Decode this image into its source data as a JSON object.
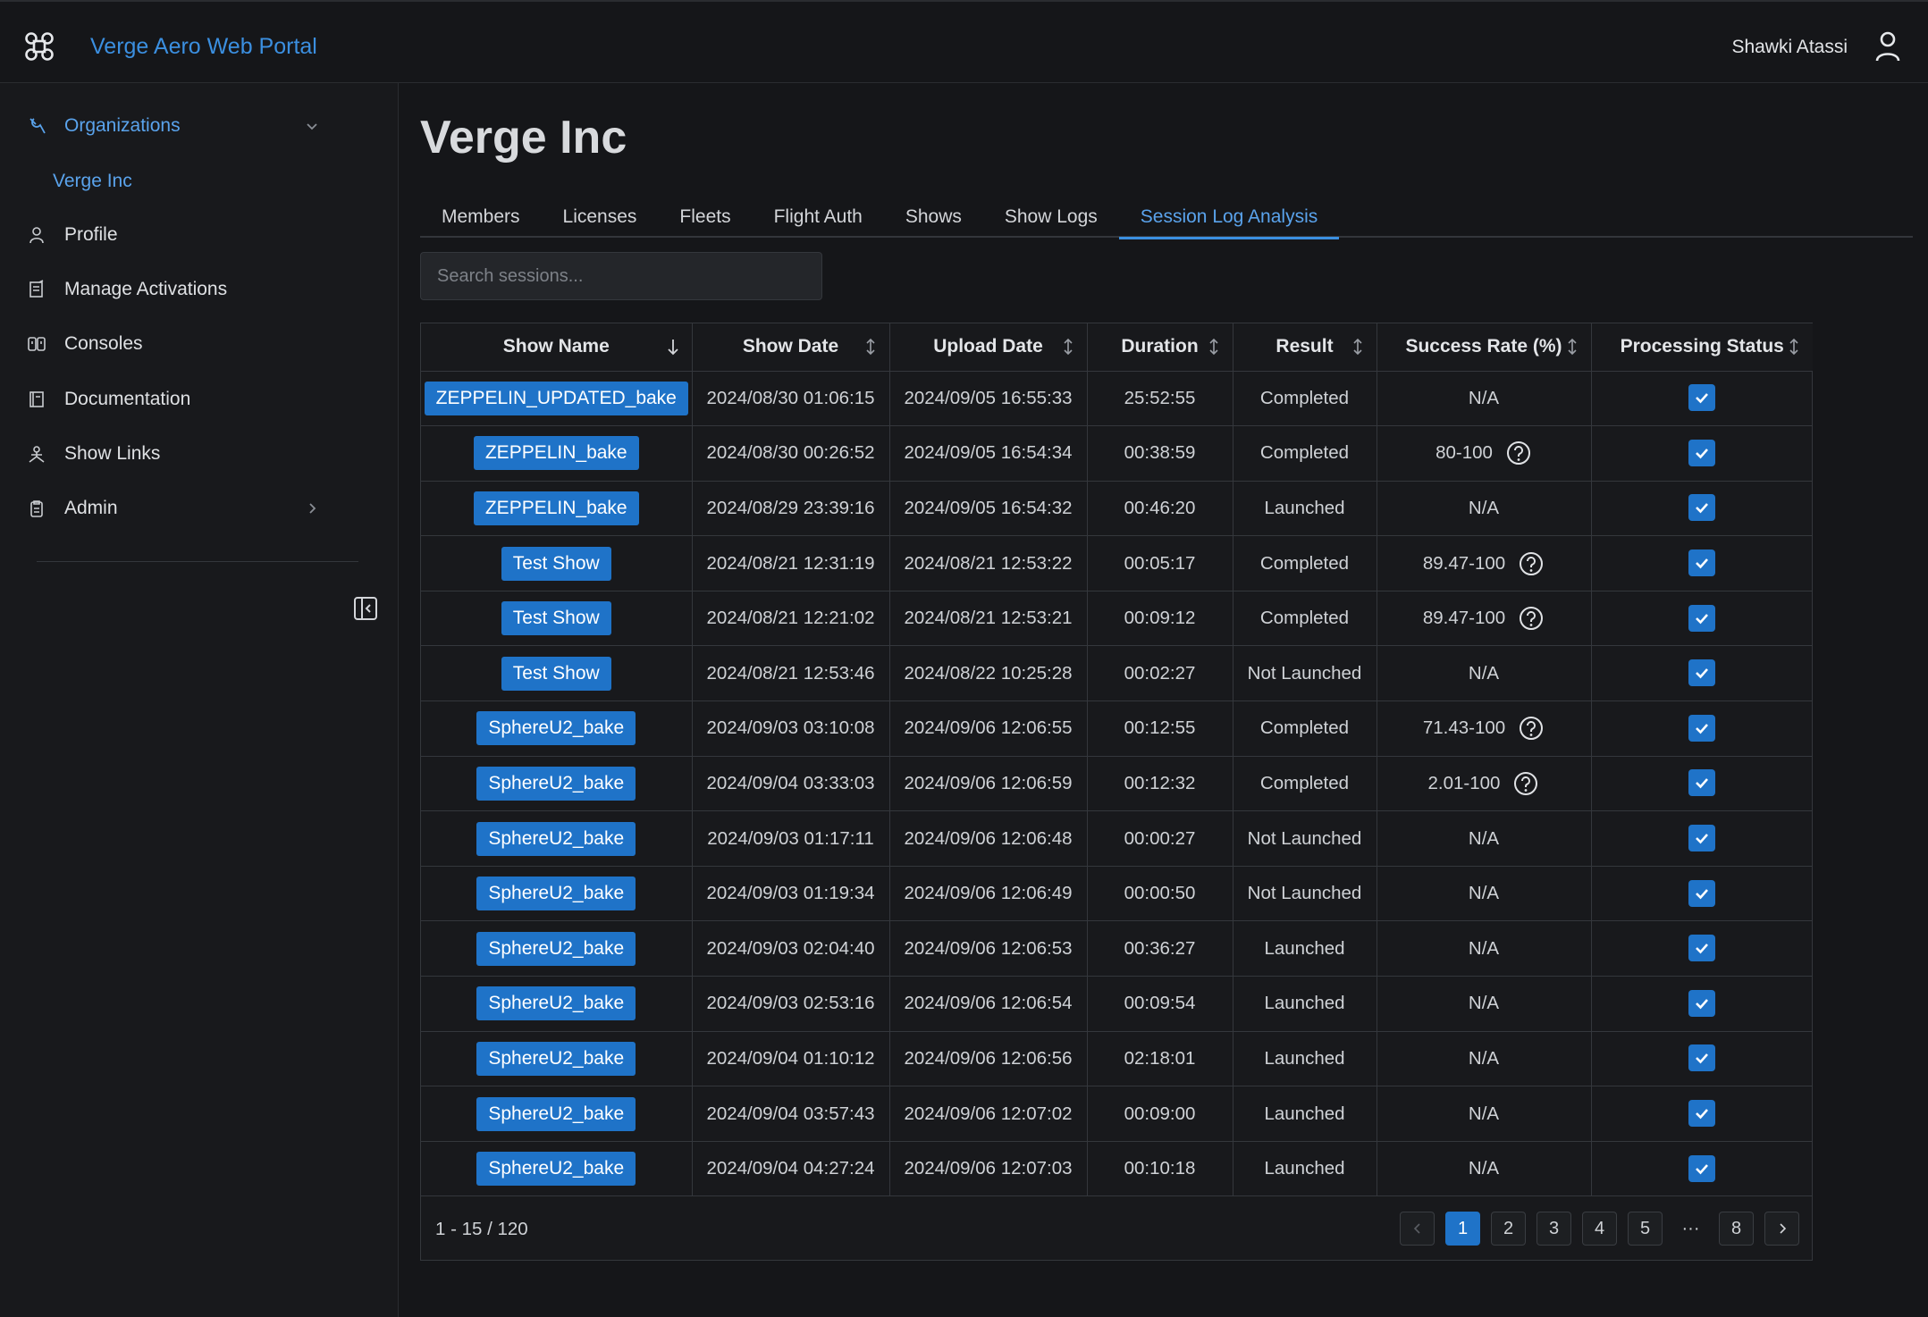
{
  "header": {
    "app_title": "Verge Aero Web Portal",
    "user_name": "Shawki Atassi"
  },
  "sidebar": {
    "items": [
      {
        "label": "Organizations",
        "icon": "wrench-icon"
      },
      {
        "label": "Verge Inc",
        "icon": ""
      },
      {
        "label": "Profile",
        "icon": "user-icon"
      },
      {
        "label": "Manage Activations",
        "icon": "activation-icon"
      },
      {
        "label": "Consoles",
        "icon": "console-icon"
      },
      {
        "label": "Documentation",
        "icon": "book-icon"
      },
      {
        "label": "Show Links",
        "icon": "drone-icon"
      },
      {
        "label": "Admin",
        "icon": "clipboard-icon"
      }
    ]
  },
  "page": {
    "title": "Verge Inc",
    "tabs": [
      "Members",
      "Licenses",
      "Fleets",
      "Flight Auth",
      "Shows",
      "Show Logs",
      "Session Log Analysis"
    ],
    "active_tab": "Session Log Analysis",
    "search_placeholder": "Search sessions..."
  },
  "table": {
    "columns": [
      "Show Name",
      "Show Date",
      "Upload Date",
      "Duration",
      "Result",
      "Success Rate (%)",
      "Processing Status"
    ],
    "rows": [
      {
        "name": "ZEPPELIN_UPDATED_bake",
        "show_date": "2024/08/30 01:06:15",
        "upload_date": "2024/09/05 16:55:33",
        "duration": "25:52:55",
        "result": "Completed",
        "rate": "N/A",
        "help": false,
        "processed": true
      },
      {
        "name": "ZEPPELIN_bake",
        "show_date": "2024/08/30 00:26:52",
        "upload_date": "2024/09/05 16:54:34",
        "duration": "00:38:59",
        "result": "Completed",
        "rate": "80-100",
        "help": true,
        "processed": true
      },
      {
        "name": "ZEPPELIN_bake",
        "show_date": "2024/08/29 23:39:16",
        "upload_date": "2024/09/05 16:54:32",
        "duration": "00:46:20",
        "result": "Launched",
        "rate": "N/A",
        "help": false,
        "processed": true
      },
      {
        "name": "Test Show",
        "show_date": "2024/08/21 12:31:19",
        "upload_date": "2024/08/21 12:53:22",
        "duration": "00:05:17",
        "result": "Completed",
        "rate": "89.47-100",
        "help": true,
        "processed": true
      },
      {
        "name": "Test Show",
        "show_date": "2024/08/21 12:21:02",
        "upload_date": "2024/08/21 12:53:21",
        "duration": "00:09:12",
        "result": "Completed",
        "rate": "89.47-100",
        "help": true,
        "processed": true
      },
      {
        "name": "Test Show",
        "show_date": "2024/08/21 12:53:46",
        "upload_date": "2024/08/22 10:25:28",
        "duration": "00:02:27",
        "result": "Not Launched",
        "rate": "N/A",
        "help": false,
        "processed": true
      },
      {
        "name": "SphereU2_bake",
        "show_date": "2024/09/03 03:10:08",
        "upload_date": "2024/09/06 12:06:55",
        "duration": "00:12:55",
        "result": "Completed",
        "rate": "71.43-100",
        "help": true,
        "processed": true
      },
      {
        "name": "SphereU2_bake",
        "show_date": "2024/09/04 03:33:03",
        "upload_date": "2024/09/06 12:06:59",
        "duration": "00:12:32",
        "result": "Completed",
        "rate": "2.01-100",
        "help": true,
        "processed": true
      },
      {
        "name": "SphereU2_bake",
        "show_date": "2024/09/03 01:17:11",
        "upload_date": "2024/09/06 12:06:48",
        "duration": "00:00:27",
        "result": "Not Launched",
        "rate": "N/A",
        "help": false,
        "processed": true
      },
      {
        "name": "SphereU2_bake",
        "show_date": "2024/09/03 01:19:34",
        "upload_date": "2024/09/06 12:06:49",
        "duration": "00:00:50",
        "result": "Not Launched",
        "rate": "N/A",
        "help": false,
        "processed": true
      },
      {
        "name": "SphereU2_bake",
        "show_date": "2024/09/03 02:04:40",
        "upload_date": "2024/09/06 12:06:53",
        "duration": "00:36:27",
        "result": "Launched",
        "rate": "N/A",
        "help": false,
        "processed": true
      },
      {
        "name": "SphereU2_bake",
        "show_date": "2024/09/03 02:53:16",
        "upload_date": "2024/09/06 12:06:54",
        "duration": "00:09:54",
        "result": "Launched",
        "rate": "N/A",
        "help": false,
        "processed": true
      },
      {
        "name": "SphereU2_bake",
        "show_date": "2024/09/04 01:10:12",
        "upload_date": "2024/09/06 12:06:56",
        "duration": "02:18:01",
        "result": "Launched",
        "rate": "N/A",
        "help": false,
        "processed": true
      },
      {
        "name": "SphereU2_bake",
        "show_date": "2024/09/04 03:57:43",
        "upload_date": "2024/09/06 12:07:02",
        "duration": "00:09:00",
        "result": "Launched",
        "rate": "N/A",
        "help": false,
        "processed": true
      },
      {
        "name": "SphereU2_bake",
        "show_date": "2024/09/04 04:27:24",
        "upload_date": "2024/09/06 12:07:03",
        "duration": "00:10:18",
        "result": "Launched",
        "rate": "N/A",
        "help": false,
        "processed": true
      }
    ]
  },
  "pagination": {
    "range_text": "1 - 15 / 120",
    "pages": [
      "1",
      "2",
      "3",
      "4",
      "5",
      "···",
      "8"
    ],
    "current": "1"
  },
  "colors": {
    "accent": "#1f73c8",
    "link": "#5aa3ec",
    "background": "#151619"
  }
}
